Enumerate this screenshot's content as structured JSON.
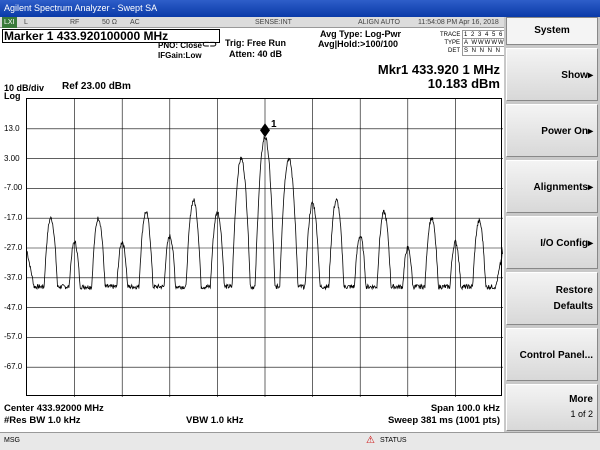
{
  "window": {
    "title": "Agilent Spectrum Analyzer - Swept SA"
  },
  "strip": {
    "badge": "LXI",
    "mode": "L",
    "input": "RF",
    "impedance": "50 Ω",
    "coupling": "AC",
    "sense": "SENSE:INT",
    "align": "ALIGN AUTO",
    "datetime": "11:54:08 PM Apr 16, 2018"
  },
  "header": {
    "marker_title": "Marker 1  433.920100000 MHz",
    "pno": "PNO: Close",
    "ifgain": "IFGain:Low",
    "trig": "Trig: Free Run",
    "atten": "Atten: 40 dB",
    "avg_type": "Avg Type: Log-Pwr",
    "avg_hold": "Avg|Hold:>100/100"
  },
  "trace_table": {
    "trace_label": "TRACE",
    "trace_val": "1 2 3 4 5 6",
    "type_label": "TYPE",
    "type_val": "A WWWWW",
    "det_label": "DET",
    "det_val": "S N N N N N"
  },
  "readout": {
    "mkr_freq": "Mkr1 433.920 1 MHz",
    "mkr_amp": "10.183 dBm"
  },
  "scale": {
    "div": "10 dB/div",
    "log": "Log",
    "ref": "Ref 23.00 dBm",
    "ticks": [
      "13.0",
      "3.00",
      "-7.00",
      "-17.0",
      "-27.0",
      "-37.0",
      "-47.0",
      "-57.0",
      "-67.0"
    ]
  },
  "marker_label": "1",
  "footer": {
    "center": "Center 433.92000 MHz",
    "rbw": "#Res BW 1.0 kHz",
    "vbw": "VBW 1.0 kHz",
    "span": "Span 100.0 kHz",
    "sweep": "Sweep  381 ms (1001 pts)"
  },
  "softkeys": {
    "header": "System",
    "items": [
      {
        "line1": "Show",
        "arrow": "▸"
      },
      {
        "line1": "Power On",
        "arrow": "▸"
      },
      {
        "line1": "Alignments",
        "arrow": "▸"
      },
      {
        "line1": "I/O Config",
        "arrow": "▸"
      },
      {
        "line1": "Restore",
        "line2": "Defaults"
      },
      {
        "line1": "Control Panel..."
      },
      {
        "line1": "More",
        "line2": "1 of 2"
      }
    ]
  },
  "statusbar": {
    "msg": "MSG",
    "status": "STATUS"
  },
  "chart_data": {
    "type": "line",
    "x_range_khz": [
      -50,
      50
    ],
    "ylim": [
      -77,
      23
    ],
    "peaks": [
      {
        "offset_khz": -45,
        "level": -17
      },
      {
        "offset_khz": -40,
        "level": -25
      },
      {
        "offset_khz": -35,
        "level": -17
      },
      {
        "offset_khz": -30,
        "level": -25
      },
      {
        "offset_khz": -25,
        "level": -15
      },
      {
        "offset_khz": -20,
        "level": -23
      },
      {
        "offset_khz": -15,
        "level": -11
      },
      {
        "offset_khz": -10,
        "level": -15
      },
      {
        "offset_khz": -5,
        "level": 3
      },
      {
        "offset_khz": 0,
        "level": 10.18
      },
      {
        "offset_khz": 5,
        "level": 3
      },
      {
        "offset_khz": 10,
        "level": -12
      },
      {
        "offset_khz": 15,
        "level": -11
      },
      {
        "offset_khz": 20,
        "level": -23
      },
      {
        "offset_khz": 25,
        "level": -15
      },
      {
        "offset_khz": 30,
        "level": -27
      },
      {
        "offset_khz": 35,
        "level": -17
      },
      {
        "offset_khz": 40,
        "level": -25
      },
      {
        "offset_khz": 45,
        "level": -18
      }
    ],
    "floor_level": -40,
    "edge_level": -28
  }
}
